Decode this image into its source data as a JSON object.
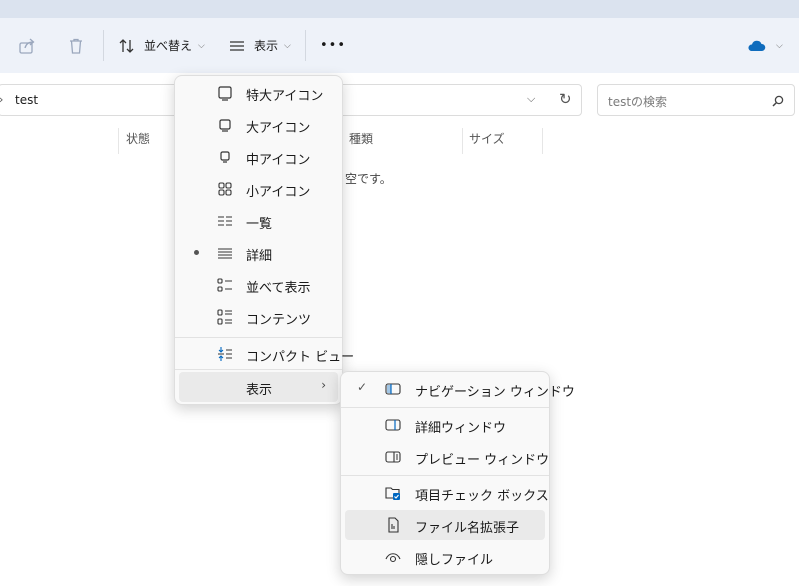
{
  "toolbar": {
    "sort_label": "並べ替え",
    "view_label": "表示",
    "more_label": "•••"
  },
  "address": {
    "path": "test"
  },
  "search": {
    "placeholder": "testの検索"
  },
  "columns": [
    "状態",
    "種類",
    "サイズ"
  ],
  "empty_message": "空です。",
  "view_menu": {
    "items": [
      {
        "label": "特大アイコン",
        "icon": "monitor-large-icon"
      },
      {
        "label": "大アイコン",
        "icon": "monitor-icon"
      },
      {
        "label": "中アイコン",
        "icon": "monitor-small-icon"
      },
      {
        "label": "小アイコン",
        "icon": "grid-icon"
      },
      {
        "label": "一覧",
        "icon": "list-icon"
      },
      {
        "label": "詳細",
        "icon": "details-icon",
        "selected": true
      },
      {
        "label": "並べて表示",
        "icon": "tiles-icon"
      },
      {
        "label": "コンテンツ",
        "icon": "content-icon"
      },
      {
        "label": "コンパクト ビュー",
        "icon": "compact-icon"
      },
      {
        "label": "表示",
        "icon": "",
        "submenu": true
      }
    ]
  },
  "show_submenu": {
    "items": [
      {
        "label": "ナビゲーション ウィンドウ",
        "icon": "nav-pane-icon",
        "checked": true
      },
      {
        "label": "詳細ウィンドウ",
        "icon": "details-pane-icon"
      },
      {
        "label": "プレビュー ウィンドウ",
        "icon": "preview-pane-icon"
      },
      {
        "label": "項目チェック ボックス",
        "icon": "checkbox-icon"
      },
      {
        "label": "ファイル名拡張子",
        "icon": "file-ext-icon"
      },
      {
        "label": "隠しファイル",
        "icon": "eye-icon"
      }
    ]
  },
  "colors": {
    "accent": "#0067c0",
    "onedrive": "#0f6cbd"
  }
}
